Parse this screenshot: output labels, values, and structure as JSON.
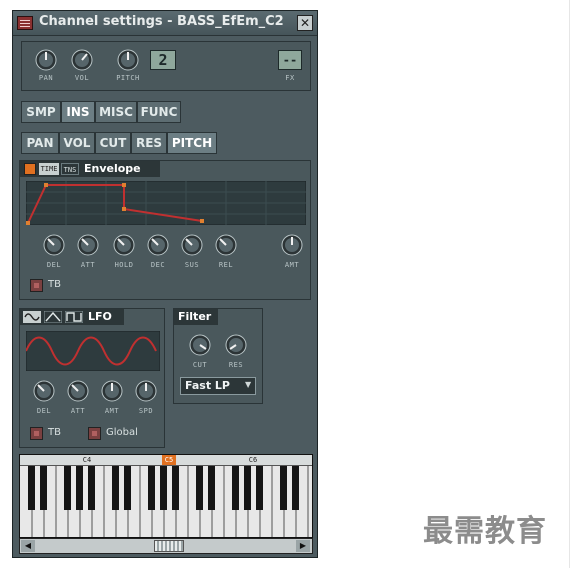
{
  "window": {
    "title": "Channel settings - BASS_EfEm_C2",
    "close_symbol": "✕"
  },
  "top_controls": {
    "pan_label": "PAN",
    "vol_label": "VOL",
    "pitch_label": "PITCH",
    "channel_number": "2",
    "fx_value": "--",
    "fx_label": "FX"
  },
  "main_tabs": [
    "SMP",
    "INS",
    "MISC",
    "FUNC"
  ],
  "active_main_tab": "INS",
  "sub_tabs": [
    "PAN",
    "VOL",
    "CUT",
    "RES",
    "PITCH"
  ],
  "active_sub_tab": "PITCH",
  "envelope": {
    "time_label": "TIME",
    "tns_label": "TNS",
    "title": "Envelope",
    "knobs": [
      "DEL",
      "ATT",
      "HOLD",
      "DEC",
      "SUS",
      "REL"
    ],
    "amount_label": "AMT",
    "tb_label": "TB"
  },
  "lfo": {
    "title": "LFO",
    "knobs": [
      "DEL",
      "ATT",
      "AMT",
      "SPD"
    ],
    "tb_label": "TB",
    "global_label": "Global"
  },
  "filter": {
    "title": "Filter",
    "cut_label": "CUT",
    "res_label": "RES",
    "type_value": "Fast LP"
  },
  "keyboard": {
    "labels": [
      "C4",
      "C5",
      "C6"
    ],
    "highlighted": "C5"
  },
  "watermark": "最需教育",
  "colors": {
    "window_bg": "#4d5b60",
    "accent_red": "#c03030",
    "lcd_green": "#8fa89c"
  }
}
